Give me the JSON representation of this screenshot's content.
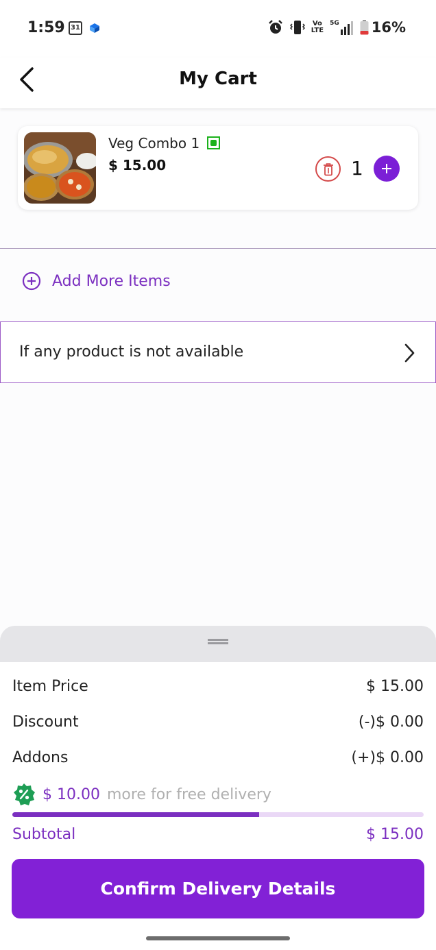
{
  "status_bar": {
    "time": "1:59",
    "calendar_day": "31",
    "network": "5G",
    "volte_line1": "Vo",
    "volte_line2": "LTE",
    "battery": "16%"
  },
  "header": {
    "title": "My Cart"
  },
  "cart": {
    "items": [
      {
        "name": "Veg Combo 1",
        "price": "$ 15.00",
        "quantity": "1",
        "veg_indicator_color": "#1bb21b",
        "thumbnail_icon": "food-thumbnail"
      }
    ],
    "add_more_label": "Add More Items",
    "unavailable_label": "If any product is not available"
  },
  "summary": {
    "item_price_label": "Item Price",
    "item_price_value": "$ 15.00",
    "discount_label": "Discount",
    "discount_value": "(-)$ 0.00",
    "addons_label": "Addons",
    "addons_value": "(+)$ 0.00",
    "free_delivery_amount": "$ 10.00",
    "free_delivery_text": "more for free delivery",
    "free_delivery_progress": 0.6,
    "subtotal_label": "Subtotal",
    "subtotal_value": "$ 15.00"
  },
  "actions": {
    "confirm_label": "Confirm Delivery Details"
  },
  "colors": {
    "accent": "#7b2fc0",
    "button": "#8221d6",
    "delete": "#d44a4a",
    "badge_green": "#1e9e55"
  }
}
